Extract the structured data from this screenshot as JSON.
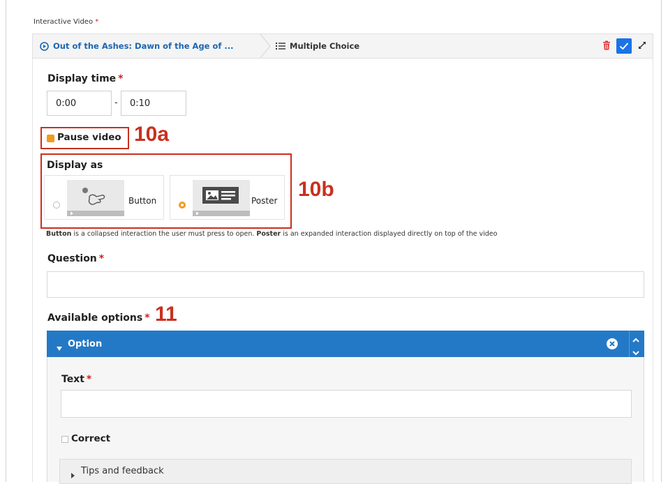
{
  "header": {
    "field_label": "Interactive Video",
    "required_mark": "*"
  },
  "breadcrumb": {
    "video_title": "Out of the Ashes: Dawn of the Age of ...",
    "current": "Multiple Choice"
  },
  "display_time": {
    "label": "Display time",
    "required_mark": "*",
    "start": "0:00",
    "separator": "-",
    "end": "0:10"
  },
  "pause_video": {
    "label": "Pause video",
    "checked": true
  },
  "display_as": {
    "label": "Display as",
    "options": [
      {
        "label": "Button",
        "selected": false
      },
      {
        "label": "Poster",
        "selected": true
      }
    ],
    "help_bold_1": "Button",
    "help_mid": " is a collapsed interaction the user must press to open. ",
    "help_bold_2": "Poster",
    "help_end": " is an expanded interaction displayed directly on top of the video"
  },
  "question": {
    "label": "Question",
    "required_mark": "*",
    "value": ""
  },
  "available_options": {
    "label": "Available options",
    "required_mark": "*",
    "option_header": "Option",
    "text_label": "Text",
    "text_required_mark": "*",
    "text_value": "",
    "correct_label": "Correct",
    "correct_checked": false,
    "tips_label": "Tips and feedback"
  },
  "annotations": {
    "a10a": "10a",
    "a10b": "10b",
    "a11": "11"
  },
  "colors": {
    "accent_blue": "#2479c6",
    "link_blue": "#1a66b3",
    "required_red": "#d21f1f",
    "annotation_red": "#c9301f",
    "radio_orange": "#f39a1c"
  }
}
